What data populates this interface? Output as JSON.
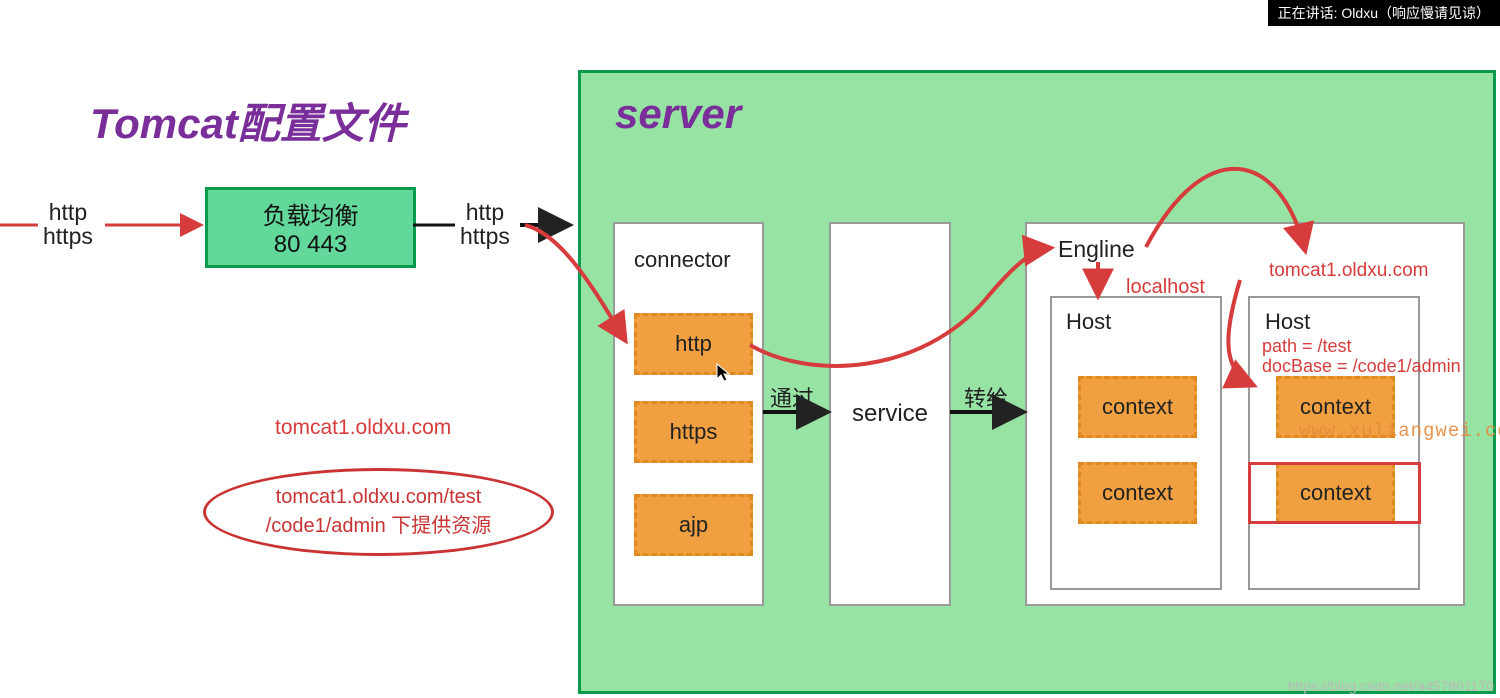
{
  "overlay": "正在讲话: Oldxu（响应慢请见谅）",
  "title": "Tomcat配置文件",
  "entry_protocols": "http\nhttps",
  "load_balancer": {
    "line1": "负载均衡",
    "line2": "80  443"
  },
  "mid_protocols": "http\nhttps",
  "domain_note": "tomcat1.oldxu.com",
  "ellipse": {
    "line1": "tomcat1.oldxu.com/test",
    "line2": "/code1/admin 下提供资源"
  },
  "server": {
    "title": "server",
    "connector": {
      "title": "connector",
      "http": "http",
      "https": "https",
      "ajp": "ajp"
    },
    "service_label": "service",
    "through": "通过",
    "forward": "转给",
    "engine": {
      "title": "Engline",
      "localhost_text": "localhost",
      "tomcat1_top": "tomcat1.oldxu.com",
      "host_label": "Host",
      "context_label": "context",
      "path_text": "path = /test",
      "docbase_text": "docBase = /code1/admin"
    }
  },
  "watermark": "www.xuliangwei.co",
  "footer_watermark": "https://blog.csdn.net/a457801170"
}
